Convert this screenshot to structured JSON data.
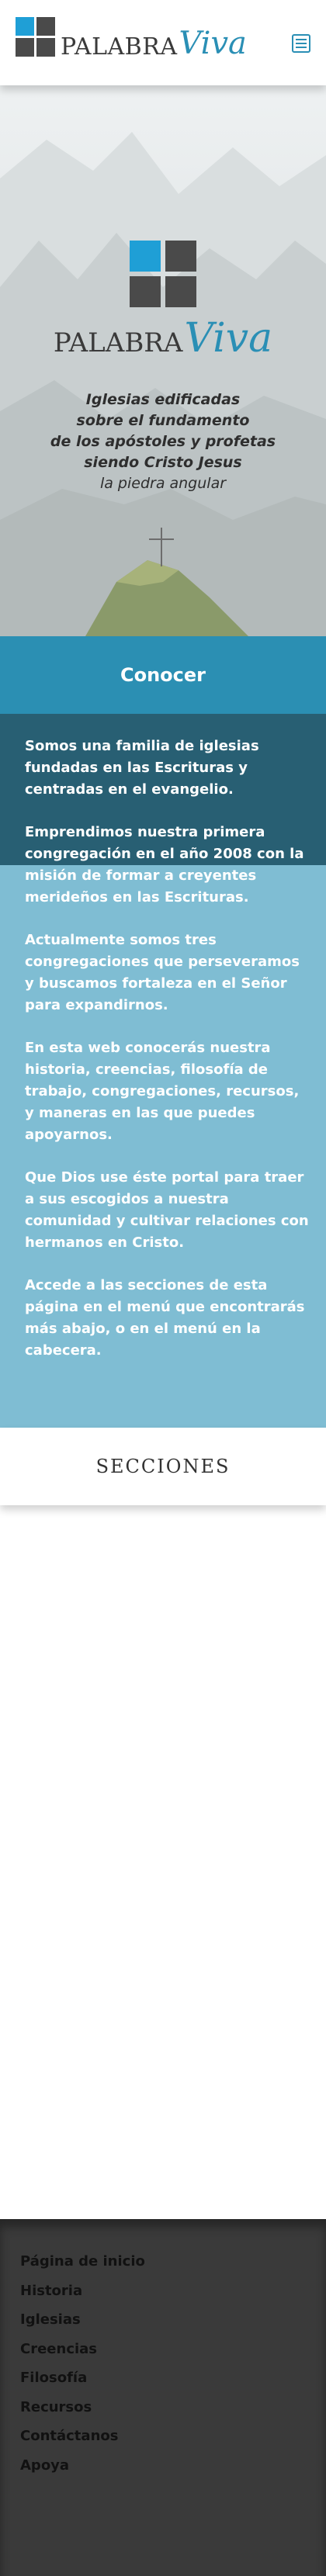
{
  "header": {
    "logo": {
      "word1": "PALABRA",
      "word2": "Viva"
    },
    "menu_icon": "hamburger-icon"
  },
  "hero": {
    "logo": {
      "word1": "PALABRA",
      "word2": "Viva"
    },
    "tagline": [
      "Iglesias edificadas",
      "sobre el fundamento",
      "de los apóstoles y profetas",
      "siendo Cristo Jesus",
      "la piedra angular"
    ]
  },
  "conocer": {
    "label": "Conocer"
  },
  "about": {
    "paragraphs": [
      "Somos una familia de iglesias fundadas en las Escrituras y centradas en el evangelio.",
      "Emprendimos nuestra primera congregación en el año 2008 con la misión de formar a creyentes merideños en las Escrituras.",
      "Actualmente somos tres congregaciones que perseveramos y buscamos fortaleza en el Señor para expandirnos.",
      "En esta web conocerás nuestra historia, creencias, filosofía de trabajo, congregaciones, recursos, y maneras en las que puedes apoyarnos.",
      "Que Dios use éste portal para traer a sus escogidos a nuestra comunidad y cultivar relaciones con hermanos en Cristo.",
      "Accede a las secciones de esta página en el menú que encontrarás más abajo, o en el menú en la cabecera."
    ]
  },
  "secciones": {
    "title": "SECCIONES"
  },
  "footer": {
    "links": [
      "Página de inicio",
      "Historia",
      "Iglesias",
      "Creencias",
      "Filosofía",
      "Recursos",
      "Contáctanos",
      "Apoya"
    ]
  },
  "colors": {
    "brand_blue": "#2a8fb5",
    "logo_blue": "#1f9fd6",
    "logo_gray": "#4a4a4a",
    "conocer_bg": "#2b8fb3",
    "about_bg": "#7fbdd3",
    "about_dark": "#285f73",
    "footer_bg": "#3a3a3a"
  }
}
